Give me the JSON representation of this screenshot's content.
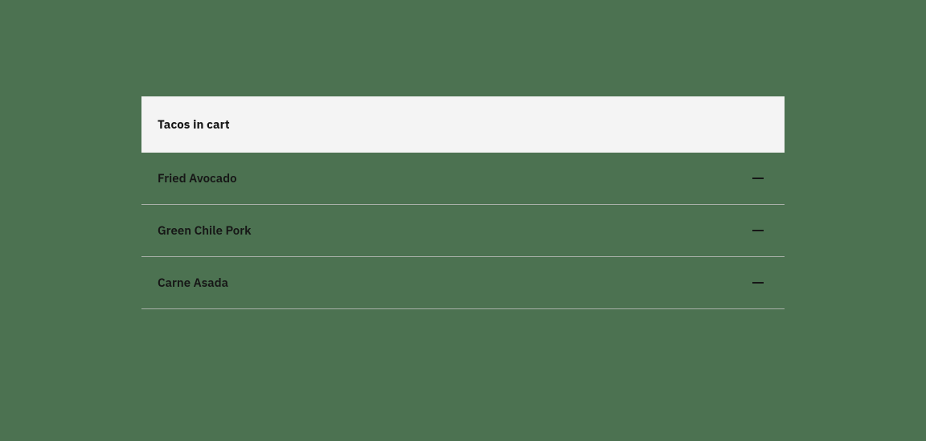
{
  "colors": {
    "background": "#4c7251",
    "header_bg": "#f4f4f4",
    "text": "#161616",
    "divider": "#a9b1a9"
  },
  "cart": {
    "title": "Tacos in cart",
    "items": [
      {
        "name": "Fried Avocado"
      },
      {
        "name": "Green Chile Pork"
      },
      {
        "name": "Carne Asada"
      }
    ]
  }
}
